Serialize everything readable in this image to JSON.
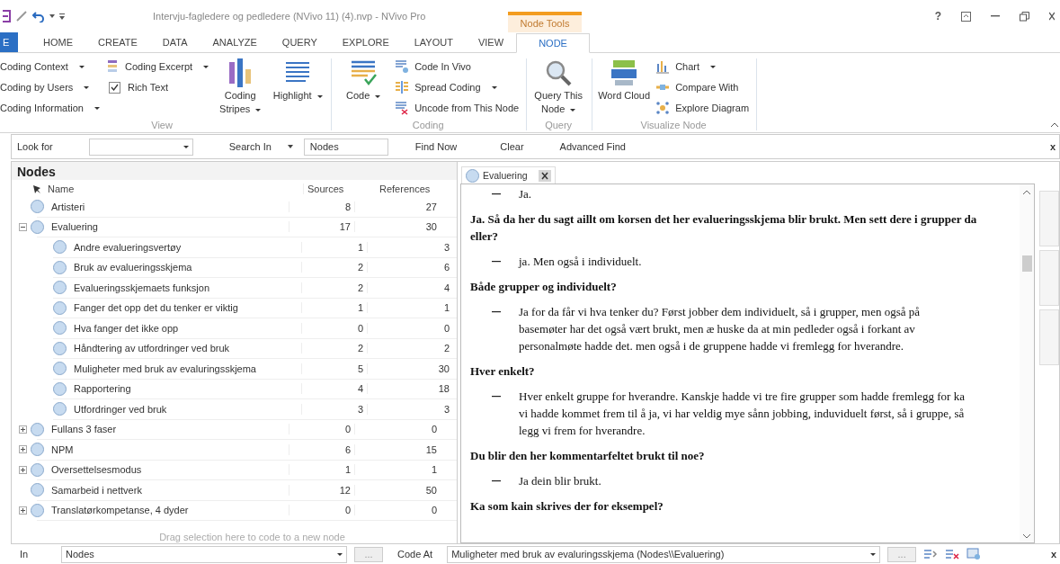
{
  "window": {
    "title": "Intervju-fagledere og pedledere (NVivo 11) (4).nvp - NVivo Pro",
    "context_tab_group": "Node Tools",
    "help": "?"
  },
  "tabs": [
    {
      "label": "E",
      "kind": "file",
      "selected": false
    },
    {
      "label": "HOME",
      "selected": false
    },
    {
      "label": "CREATE",
      "selected": false
    },
    {
      "label": "DATA",
      "selected": false
    },
    {
      "label": "ANALYZE",
      "selected": false
    },
    {
      "label": "QUERY",
      "selected": false
    },
    {
      "label": "EXPLORE",
      "selected": false
    },
    {
      "label": "LAYOUT",
      "selected": false
    },
    {
      "label": "VIEW",
      "selected": false
    },
    {
      "label": "NODE",
      "selected": true
    }
  ],
  "ribbon": [
    {
      "label": "View",
      "columns": [
        {
          "kind": "stack",
          "items": [
            {
              "label": "Coding Context",
              "dropdown": true
            },
            {
              "label": "Coding by Users",
              "dropdown": true
            },
            {
              "label": "Coding Information",
              "dropdown": true
            }
          ]
        },
        {
          "kind": "stack",
          "items": [
            {
              "label": "Coding Excerpt",
              "dropdown": true,
              "kind": "button"
            },
            {
              "label": "Rich Text",
              "kind": "check",
              "checked": true
            }
          ]
        },
        {
          "kind": "large",
          "label": "Coding Stripes",
          "dropdown": true
        },
        {
          "kind": "large",
          "label": "Highlight",
          "dropdown": true
        }
      ]
    },
    {
      "label": "Coding",
      "columns": [
        {
          "kind": "large",
          "label": "Code",
          "dropdown": true
        },
        {
          "kind": "stack",
          "items": [
            {
              "label": "Code In Vivo",
              "kind": "button"
            },
            {
              "label": "Spread Coding",
              "dropdown": true,
              "kind": "button"
            },
            {
              "label": "Uncode from This Node",
              "kind": "button"
            }
          ]
        }
      ]
    },
    {
      "label": "Query",
      "columns": [
        {
          "kind": "large",
          "label": "Query This Node",
          "dropdown": true
        }
      ]
    },
    {
      "label": "Visualize Node",
      "columns": [
        {
          "kind": "large",
          "label": "Word Cloud"
        },
        {
          "kind": "stack",
          "items": [
            {
              "label": "Chart",
              "dropdown": true,
              "kind": "button"
            },
            {
              "label": "Compare With",
              "kind": "button"
            },
            {
              "label": "Explore Diagram",
              "kind": "button"
            }
          ]
        }
      ]
    }
  ],
  "find_bar": {
    "look_for_label": "Look for",
    "search_in": "Search In",
    "search_in_value": "Nodes",
    "find_now": "Find Now",
    "clear": "Clear",
    "advanced_find": "Advanced Find",
    "close": "x"
  },
  "nodes": {
    "title": "Nodes",
    "columns": [
      "Name",
      "Sources",
      "References"
    ],
    "rows": [
      {
        "name": "Artisteri",
        "sources": "8",
        "references": "27"
      },
      {
        "name": "Evaluering",
        "sources": "17",
        "references": "30",
        "expanded": true,
        "children": [
          {
            "name": "Andre evalueringsvertøy",
            "sources": "1",
            "references": "3"
          },
          {
            "name": "Bruk av evalueringsskjema",
            "sources": "2",
            "references": "6"
          },
          {
            "name": "Evalueringsskjemaets funksjon",
            "sources": "2",
            "references": "4"
          },
          {
            "name": "Fanger det opp det du tenker er viktig",
            "sources": "1",
            "references": "1"
          },
          {
            "name": "Hva fanger det ikke opp",
            "sources": "0",
            "references": "0"
          },
          {
            "name": "Håndtering av utfordringer ved bruk",
            "sources": "2",
            "references": "2"
          },
          {
            "name": "Muligheter med bruk av evaluringsskjema",
            "sources": "5",
            "references": "30"
          },
          {
            "name": "Rapportering",
            "sources": "4",
            "references": "18"
          },
          {
            "name": "Utfordringer ved bruk",
            "sources": "3",
            "references": "3"
          }
        ]
      },
      {
        "name": "Fullans 3 faser",
        "sources": "0",
        "references": "0",
        "expanded": false
      },
      {
        "name": "NPM",
        "sources": "6",
        "references": "15",
        "expanded": false
      },
      {
        "name": "Oversettelsesmodus",
        "sources": "1",
        "references": "1",
        "expanded": false
      },
      {
        "name": "Samarbeid i nettverk",
        "sources": "12",
        "references": "50"
      },
      {
        "name": "Translatørkompetanse, 4 dyder",
        "sources": "0",
        "references": "0",
        "expanded": false
      }
    ],
    "drop_hint": "Drag selection here to code to a new node"
  },
  "document": {
    "tab": "Evaluering",
    "paragraphs": [
      {
        "kind": "answer",
        "text": "Ja."
      },
      {
        "kind": "question",
        "text": "Ja. Så da her du sagt aillt om korsen det her evalueringsskjema blir brukt. Men sett dere i grupper da eller?"
      },
      {
        "kind": "answer",
        "text": "ja. Men også i individuelt."
      },
      {
        "kind": "question",
        "text": "Både grupper og individuelt?"
      },
      {
        "kind": "answer",
        "text": "Ja for da får vi hva tenker du? Først jobber dem individuelt, så i grupper, men også på basemøter har det også vært brukt, men æ huske da at min pedleder også i forkant av personalmøte hadde det. men også i de gruppene hadde vi fremlegg for hverandre."
      },
      {
        "kind": "question",
        "text": "Hver enkelt?"
      },
      {
        "kind": "answer",
        "text": "Hver enkelt gruppe for hverandre. Kanskje hadde vi tre fire grupper som hadde fremlegg for ka vi hadde kommet frem til å ja, vi har veldig mye sånn jobbing, induviduelt først, så i gruppe, så legg vi frem for hverandre."
      },
      {
        "kind": "question",
        "text": "Du blir den her kommentarfeltet brukt til noe?"
      },
      {
        "kind": "answer",
        "text": "Ja dein blir brukt."
      },
      {
        "kind": "question",
        "text": "Ka som kain skrives der for eksempel?"
      }
    ]
  },
  "code_bar": {
    "in_label": "In",
    "in_value": "Nodes",
    "browse": "...",
    "code_at_label": "Code At",
    "code_at_value": "Muligheter med bruk av evaluringsskjema (Nodes\\\\Evaluering)",
    "browse_2": "...",
    "close": "x"
  }
}
